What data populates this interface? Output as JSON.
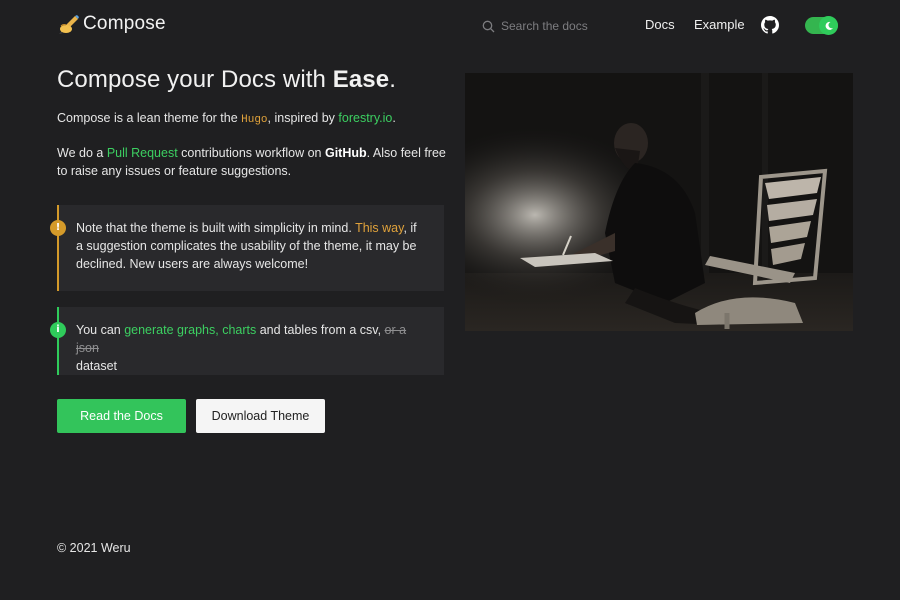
{
  "header": {
    "logo_emoji": "✍️",
    "logo_text": "Compose",
    "search_placeholder": "Search the docs",
    "nav": [
      {
        "label": "Docs"
      },
      {
        "label": "Example"
      }
    ],
    "github_icon": "github-icon",
    "theme_toggle_icon": "moon-icon",
    "theme_toggle_on": true
  },
  "main": {
    "title_prefix": "Compose your Docs with ",
    "title_emphasis": "Ease",
    "title_suffix": ".",
    "intro": {
      "text1": "Compose is a lean theme for the ",
      "hugo": "Hugo",
      "text2": ", inspired by ",
      "forestry": "forestry.io",
      "text3": "."
    },
    "contrib": {
      "text1": "We do a ",
      "pull_request": "Pull Request",
      "text2": " contributions workflow on ",
      "github": "GitHub",
      "text3": ". Also feel free to raise any issues or feature suggestions."
    },
    "notice_warning": {
      "icon": "!",
      "text1": "Note that the theme is built with simplicity in mind. ",
      "link": "This way",
      "text2": ", if a suggestion complicates the usability of the theme, it may be declined. New users are always welcome!"
    },
    "notice_info": {
      "icon": "i",
      "text1": "You can ",
      "link1": "generate graphs",
      "comma": ", ",
      "link2": "charts",
      "text2": " and tables from a csv, ",
      "strike": "or a json",
      "text3": " dataset"
    },
    "buttons": {
      "primary": "Read the Docs",
      "secondary": "Download Theme"
    }
  },
  "footer": {
    "copyright": "© 2021 Weru"
  },
  "colors": {
    "background": "#1f1f21",
    "accent_green": "#33c45b",
    "accent_orange": "#d49a2a"
  }
}
